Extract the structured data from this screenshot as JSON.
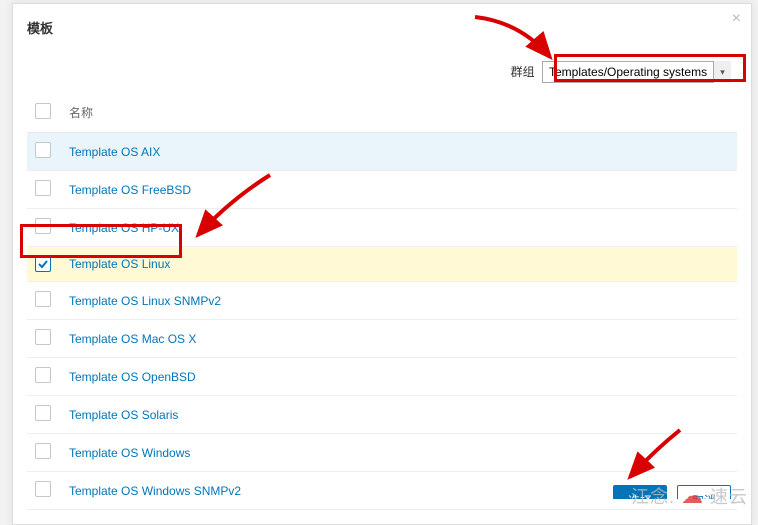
{
  "modal": {
    "title": "模板",
    "close": "×"
  },
  "filter": {
    "label": "群组",
    "selected": "Templates/Operating systems"
  },
  "table": {
    "header_name": "名称",
    "rows": [
      {
        "name": "Template OS AIX",
        "checked": false,
        "state": "hover"
      },
      {
        "name": "Template OS FreeBSD",
        "checked": false,
        "state": ""
      },
      {
        "name": "Template OS HP-UX",
        "checked": false,
        "state": ""
      },
      {
        "name": "Template OS Linux",
        "checked": true,
        "state": "selected"
      },
      {
        "name": "Template OS Linux SNMPv2",
        "checked": false,
        "state": ""
      },
      {
        "name": "Template OS Mac OS X",
        "checked": false,
        "state": ""
      },
      {
        "name": "Template OS OpenBSD",
        "checked": false,
        "state": ""
      },
      {
        "name": "Template OS Solaris",
        "checked": false,
        "state": ""
      },
      {
        "name": "Template OS Windows",
        "checked": false,
        "state": ""
      },
      {
        "name": "Template OS Windows SNMPv2",
        "checked": false,
        "state": ""
      }
    ]
  },
  "buttons": {
    "select": "选择",
    "cancel": "取消"
  },
  "watermark": {
    "text_left": "江念.",
    "text_right": "速云"
  }
}
